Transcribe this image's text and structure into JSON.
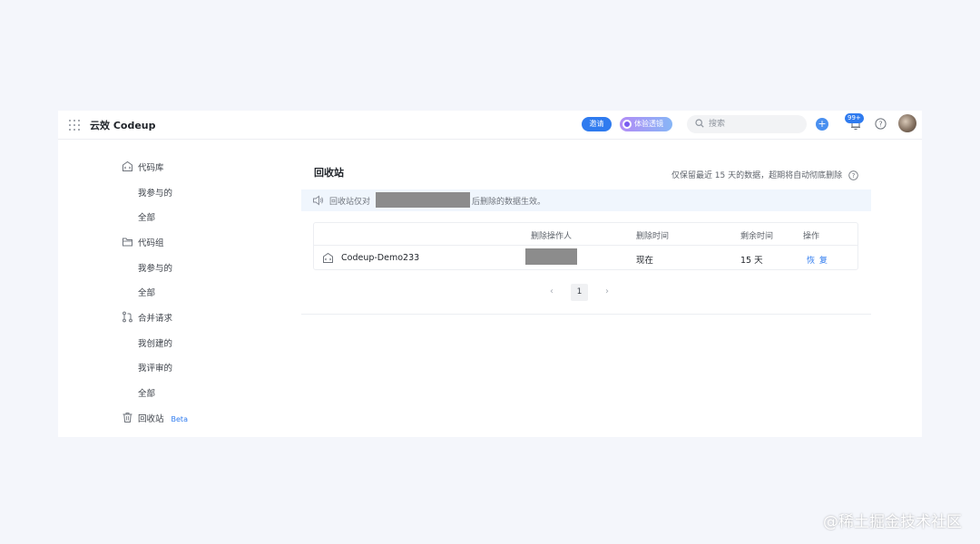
{
  "header": {
    "app_title": "云效 Codeup",
    "invite_label": "邀请",
    "experience_label": "体验透镜",
    "search_placeholder": "搜索",
    "add_label": "+",
    "notification_badge": "99+"
  },
  "sidebar": {
    "groups": [
      {
        "label": "代码库",
        "icon": "repo-icon",
        "items": [
          "我参与的",
          "全部"
        ]
      },
      {
        "label": "代码组",
        "icon": "folder-icon",
        "items": [
          "我参与的",
          "全部"
        ]
      },
      {
        "label": "合并请求",
        "icon": "merge-request-icon",
        "items": [
          "我创建的",
          "我评审的",
          "全部"
        ]
      },
      {
        "label": "回收站",
        "icon": "trash-icon",
        "badge": "Beta",
        "items": []
      }
    ]
  },
  "main": {
    "title": "回收站",
    "retention_note": "仅保留最近 15 天的数据，超期将自动彻底删除",
    "notice": {
      "prefix": "回收站仅对",
      "suffix": "后删除的数据生效。"
    },
    "table": {
      "columns": [
        "删除操作人",
        "删除时间",
        "剩余时间",
        "操作"
      ],
      "rows": [
        {
          "name": "Codeup-Demo233",
          "deleted_time": "现在",
          "remaining": "15 天",
          "action": "恢 复"
        }
      ]
    },
    "pagination": {
      "prev": "‹",
      "current": "1",
      "next": "›"
    }
  },
  "watermark": "@稀土掘金技术社区",
  "colors": {
    "accent": "#2f7bef",
    "notice_bg": "#f0f6fd",
    "page_bg": "#f4f6fb"
  }
}
